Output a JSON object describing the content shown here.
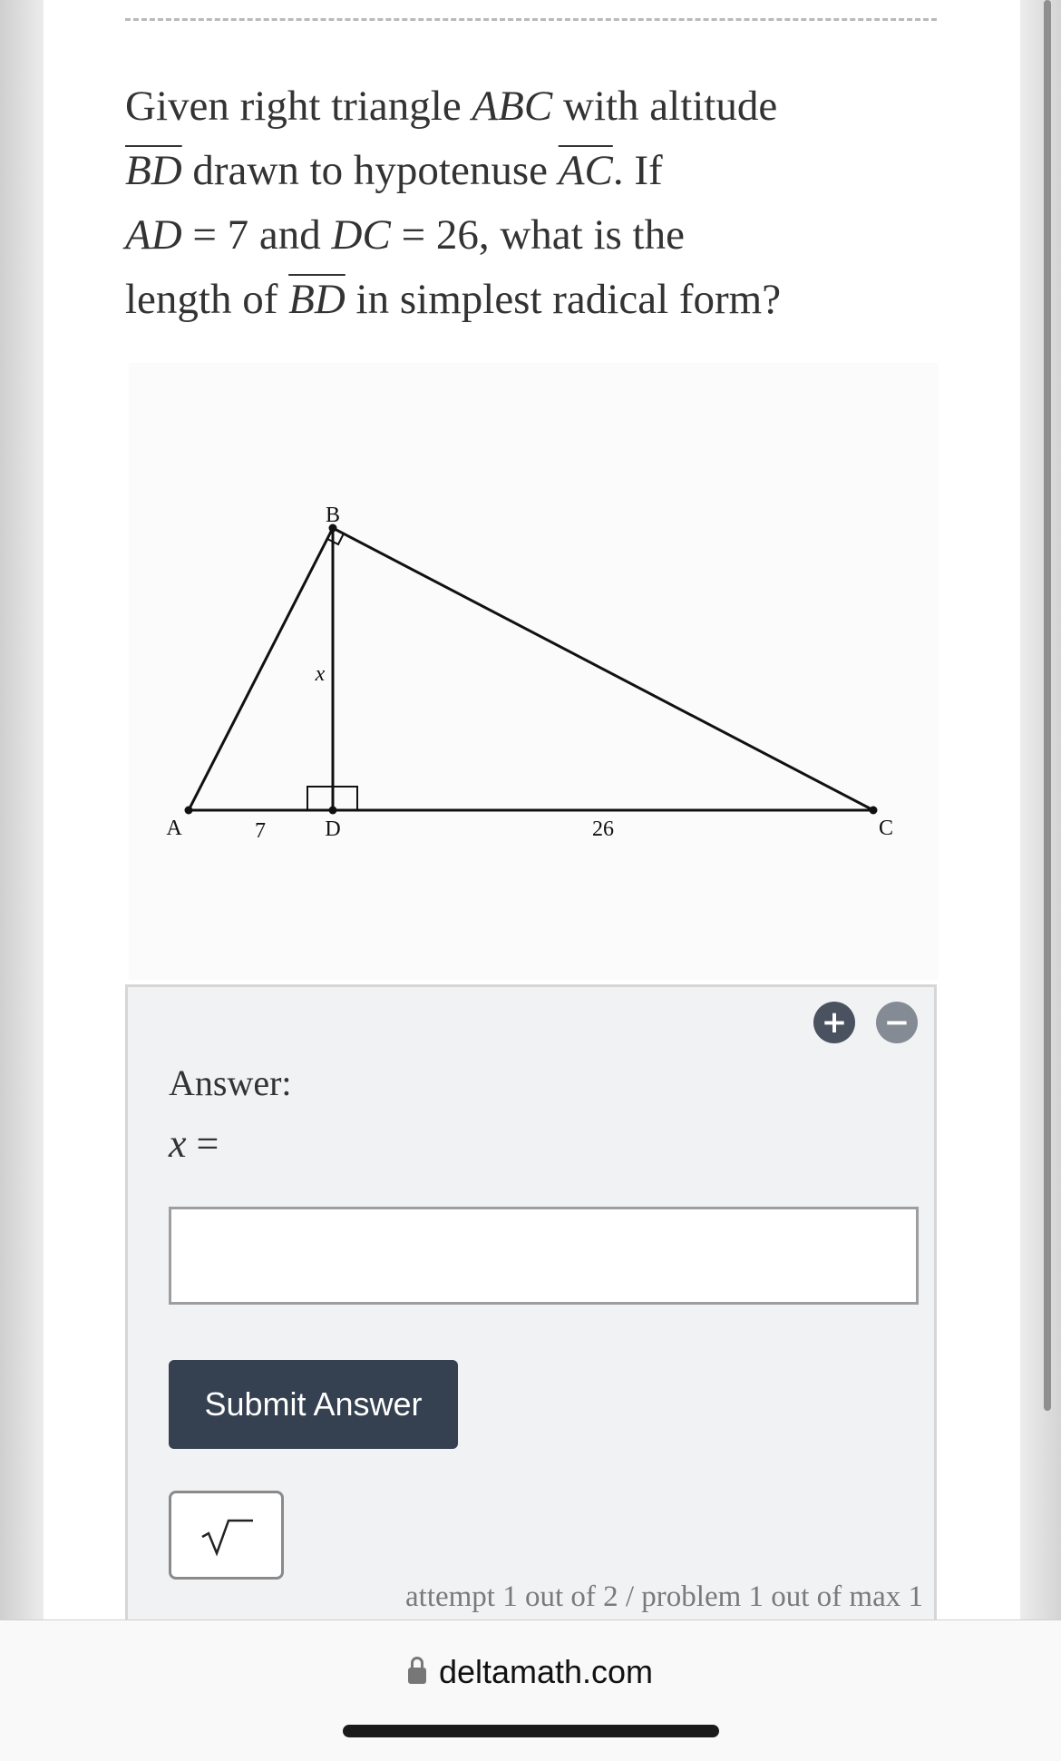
{
  "question": {
    "p1": "Given right triangle ",
    "m_abc": "ABC",
    "p2": " with altitude",
    "m_bd1": "BD",
    "p3": " drawn to hypotenuse ",
    "m_ac": "AC",
    "p4": ". If",
    "m_ad": "AD",
    "eq1": " = 7 and ",
    "m_dc": "DC",
    "eq2": " = 26, what is the",
    "p5": "length of ",
    "m_bd2": "BD",
    "p6": " in simplest radical form?"
  },
  "figure": {
    "label_a": "A",
    "label_b": "B",
    "label_c": "C",
    "label_d": "D",
    "label_x": "x",
    "label_ad": "7",
    "label_dc": "26"
  },
  "answer": {
    "label": "Answer:",
    "var": "x",
    "equals": " =",
    "input_value": "",
    "plus_symbol": "+",
    "minus_symbol": "−",
    "submit_label": "Submit Answer",
    "sqrt_icon": "square-root-icon",
    "attempt_text": "attempt 1 out of 2 / problem 1 out of max 1"
  },
  "browser": {
    "url": "deltamath.com",
    "lock_icon": "lock-icon"
  },
  "colors": {
    "submit_bg": "#354050",
    "panel_bg": "#f1f2f4",
    "plus_bg": "#4a5260",
    "minus_bg": "#858b94"
  }
}
